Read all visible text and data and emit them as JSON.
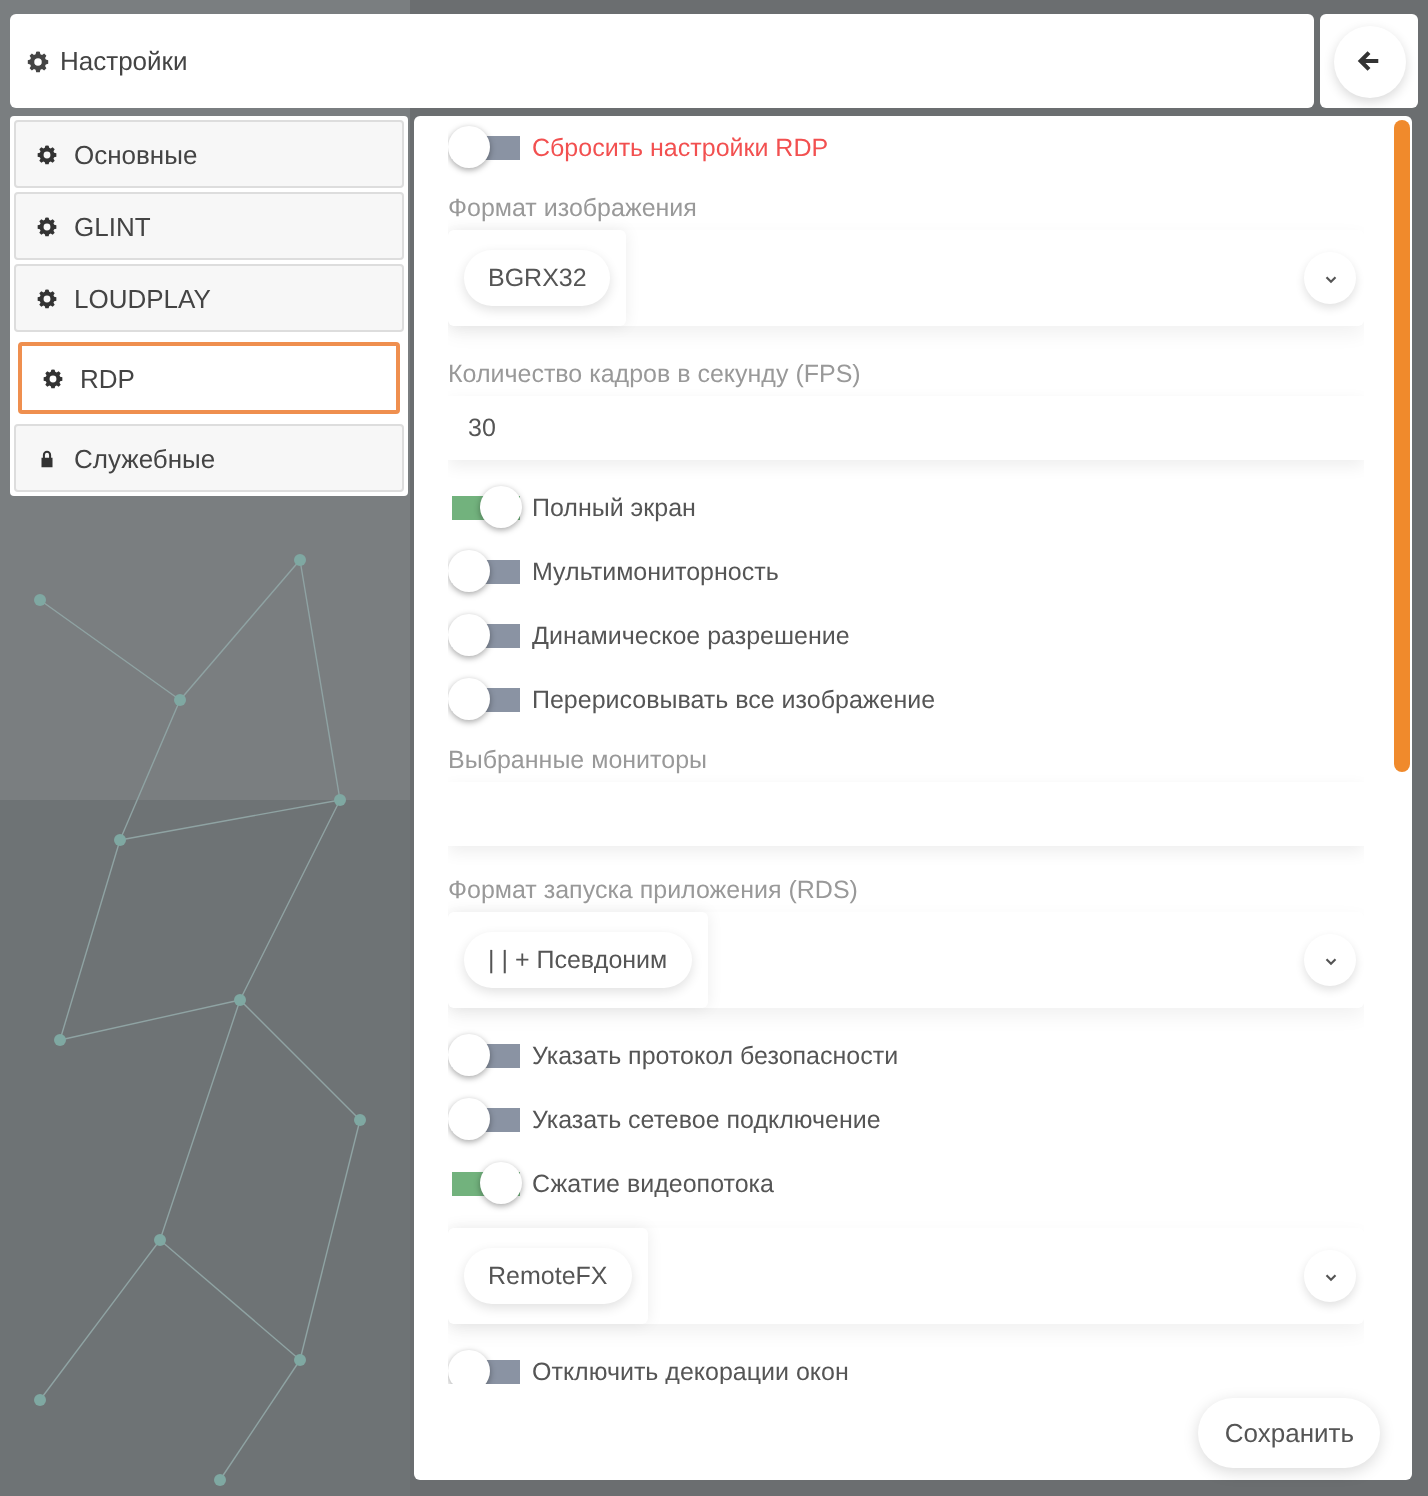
{
  "header": {
    "title": "Настройки"
  },
  "sidebar": {
    "items": [
      {
        "label": "Основные",
        "locked": false,
        "selected": false
      },
      {
        "label": "GLINT",
        "locked": false,
        "selected": false
      },
      {
        "label": "LOUDPLAY",
        "locked": false,
        "selected": false
      },
      {
        "label": "RDP",
        "locked": false,
        "selected": true
      },
      {
        "label": "Служебные",
        "locked": true,
        "selected": false
      }
    ]
  },
  "form": {
    "items": [
      {
        "kind": "danger-toggle",
        "label": "Сбросить настройки RDP",
        "on": false
      },
      {
        "kind": "select",
        "label": "Формат изображения",
        "value": "BGRX32"
      },
      {
        "kind": "input",
        "label": "Количество кадров в секунду (FPS)",
        "value": "30"
      },
      {
        "kind": "toggle",
        "label": "Полный экран",
        "on": true
      },
      {
        "kind": "toggle",
        "label": "Мультимониторность",
        "on": false
      },
      {
        "kind": "toggle",
        "label": "Динамическое разрешение",
        "on": false
      },
      {
        "kind": "toggle",
        "label": "Перерисовывать все изображение",
        "on": false
      },
      {
        "kind": "input",
        "label": "Выбранные мониторы"
      },
      {
        "kind": "select",
        "label": "Формат запуска приложения (RDS)",
        "value": "| | + Псевдоним"
      },
      {
        "kind": "toggle",
        "label": "Указать протокол безопасности",
        "on": false
      },
      {
        "kind": "toggle",
        "label": "Указать сетевое подключение",
        "on": false
      },
      {
        "kind": "toggle",
        "label": "Сжатие видеопотока",
        "on": true
      },
      {
        "kind": "select",
        "value": "RemoteFX"
      },
      {
        "kind": "toggle",
        "label": "Отключить декорации окон",
        "on": false
      }
    ]
  },
  "save_button": "Сохранить"
}
